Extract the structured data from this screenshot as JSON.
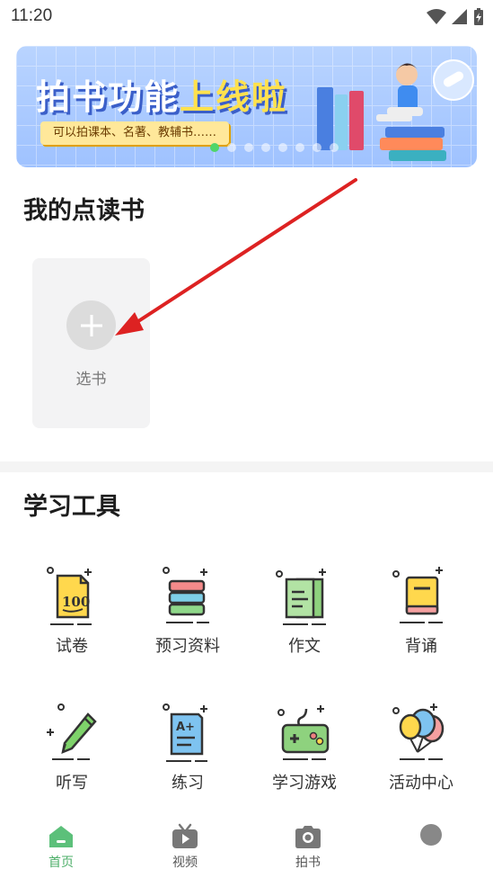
{
  "status_bar": {
    "time": "11:20"
  },
  "banner": {
    "title_part1": "拍书功能",
    "title_part2": "上线啦",
    "subtitle": "可以拍课本、名著、教辅书……",
    "colors": {
      "background": "#a8c9ff",
      "highlight": "#ffe14d",
      "active_dot": "#4fd56a"
    }
  },
  "my_books": {
    "title": "我的点读书",
    "add_label": "选书"
  },
  "tools": {
    "title": "学习工具",
    "items": [
      {
        "label": "试卷",
        "icon": "test-paper-icon"
      },
      {
        "label": "预习资料",
        "icon": "book-stack-icon"
      },
      {
        "label": "作文",
        "icon": "composition-icon"
      },
      {
        "label": "背诵",
        "icon": "recite-book-icon"
      },
      {
        "label": "听写",
        "icon": "pencil-icon"
      },
      {
        "label": "练习",
        "icon": "practice-sheet-icon"
      },
      {
        "label": "学习游戏",
        "icon": "game-controller-icon"
      },
      {
        "label": "活动中心",
        "icon": "balloons-icon"
      }
    ]
  },
  "bottom_nav": {
    "items": [
      {
        "label": "首页",
        "icon": "home-icon",
        "active": true
      },
      {
        "label": "视频",
        "icon": "video-icon",
        "active": false
      },
      {
        "label": "拍书",
        "icon": "camera-icon",
        "active": false
      },
      {
        "label": "",
        "icon": "profile-icon",
        "active": false
      }
    ],
    "accent_color": "#4caf68"
  }
}
